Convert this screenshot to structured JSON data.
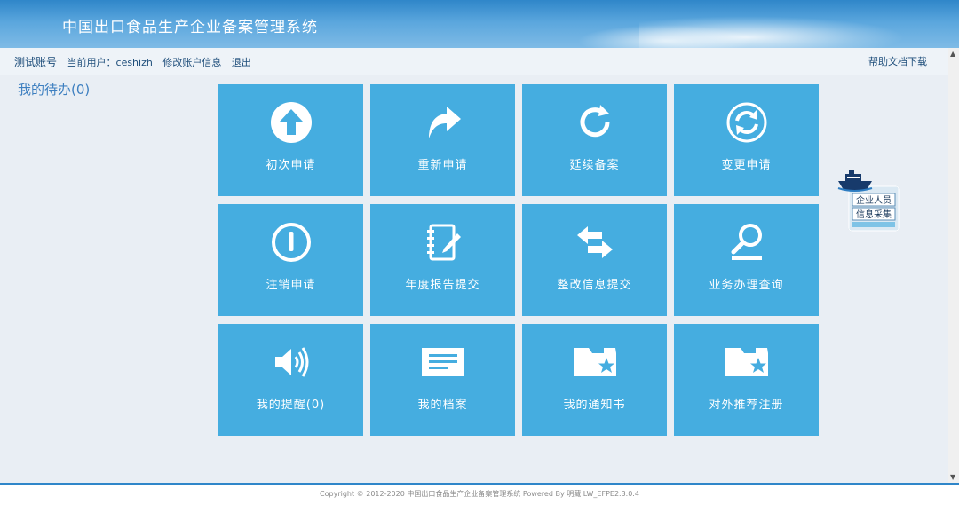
{
  "header": {
    "title": "中国出口食品生产企业备案管理系统"
  },
  "toolbar": {
    "account": "测试账号",
    "current_user_label": "当前用户：",
    "username": "ceshizh",
    "edit_account": "修改账户信息",
    "logout": "退出",
    "help_download": "帮助文档下载"
  },
  "todo": {
    "label": "我的待办(0)"
  },
  "tiles": [
    {
      "label": "初次申请",
      "icon": "arrow-up-circle-icon"
    },
    {
      "label": "重新申请",
      "icon": "redo-arrow-icon"
    },
    {
      "label": "延续备案",
      "icon": "refresh-icon"
    },
    {
      "label": "变更申请",
      "icon": "sync-circle-icon"
    },
    {
      "label": "注销申请",
      "icon": "power-circle-icon"
    },
    {
      "label": "年度报告提交",
      "icon": "notebook-pen-icon"
    },
    {
      "label": "整改信息提交",
      "icon": "swap-arrows-icon"
    },
    {
      "label": "业务办理查询",
      "icon": "magnifier-icon"
    },
    {
      "label": "我的提醒(0)",
      "icon": "speaker-icon"
    },
    {
      "label": "我的档案",
      "icon": "document-lines-icon"
    },
    {
      "label": "我的通知书",
      "icon": "folder-star-icon"
    },
    {
      "label": "对外推荐注册",
      "icon": "folder-star-icon"
    }
  ],
  "side_badge": {
    "line1": "企业人员",
    "line2": "信息采集",
    "icon": "ship-icon"
  },
  "footer": {
    "text": "Copyright © 2012-2020 中国出口食品生产企业备案管理系统 Powered By 明藏 LW_EFPE2.3.0.4"
  },
  "colors": {
    "tile": "#45ade0",
    "header": "#2f86c9"
  }
}
